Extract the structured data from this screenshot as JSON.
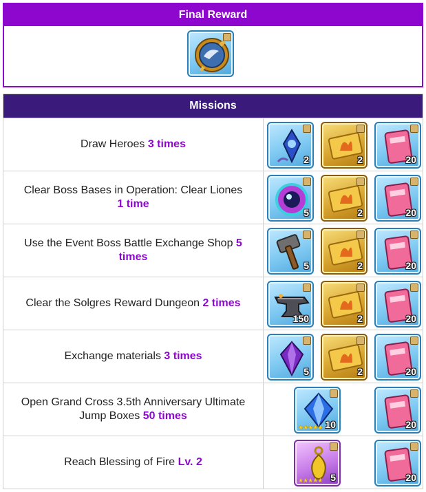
{
  "final_reward": {
    "title": "Final Reward",
    "item": {
      "icon": "compass-mirror-icon",
      "quantity": ""
    }
  },
  "missions": {
    "title": "Missions",
    "rows": [
      {
        "text": "Draw Heroes ",
        "highlight": "3 times",
        "rewards": [
          {
            "icon": "blue-gem-pendant-icon",
            "quantity": "2"
          },
          {
            "icon": "gold-ticket-icon",
            "quantity": "2"
          },
          {
            "icon": "pink-ticket-icon",
            "quantity": "20"
          }
        ]
      },
      {
        "text": "Clear Boss Bases in Operation: Clear Liones",
        "highlight": "1 time",
        "rewards": [
          {
            "icon": "purple-orb-icon",
            "quantity": "5"
          },
          {
            "icon": "gold-ticket-icon",
            "quantity": "2"
          },
          {
            "icon": "pink-ticket-icon",
            "quantity": "20"
          }
        ]
      },
      {
        "text": "Use the Event Boss Battle Exchange Shop ",
        "highlight": "5 times",
        "rewards": [
          {
            "icon": "hammer-icon",
            "quantity": "5"
          },
          {
            "icon": "gold-ticket-icon",
            "quantity": "2"
          },
          {
            "icon": "pink-ticket-icon",
            "quantity": "20"
          }
        ]
      },
      {
        "text": "Clear the Solgres Reward Dungeon ",
        "highlight": "2 times",
        "rewards": [
          {
            "icon": "anvil-icon",
            "quantity": "150"
          },
          {
            "icon": "gold-ticket-icon",
            "quantity": "2"
          },
          {
            "icon": "pink-ticket-icon",
            "quantity": "20"
          }
        ]
      },
      {
        "text": "Exchange materials ",
        "highlight": "3 times",
        "rewards": [
          {
            "icon": "purple-crystal-icon",
            "quantity": "5"
          },
          {
            "icon": "gold-ticket-icon",
            "quantity": "2"
          },
          {
            "icon": "pink-ticket-icon",
            "quantity": "20"
          }
        ]
      },
      {
        "text": "Open Grand Cross 3.5th Anniversary Ultimate Jump Boxes ",
        "highlight": "50 times",
        "rewards": [
          {
            "icon": "blue-diamond-icon",
            "quantity": "10",
            "stars": "★★★★★"
          },
          {
            "icon": "pink-ticket-icon",
            "quantity": "20"
          }
        ]
      },
      {
        "text": "Reach Blessing of Fire ",
        "highlight": "Lv. 2",
        "rewards": [
          {
            "icon": "gold-amulet-icon",
            "quantity": "5",
            "stars": "★★★★★"
          },
          {
            "icon": "pink-ticket-icon",
            "quantity": "20"
          }
        ]
      }
    ]
  },
  "colors": {
    "final_header": "#8e07cf",
    "missions_header": "#3a1a7a",
    "highlight": "#8e07cf"
  }
}
